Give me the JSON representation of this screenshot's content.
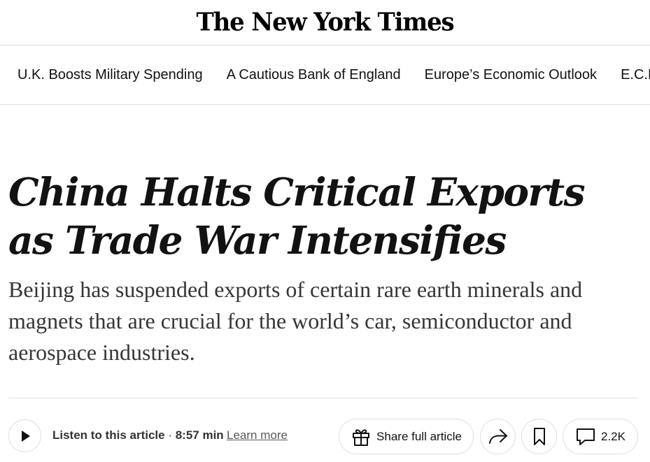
{
  "masthead": {
    "logo_text": "The New York Times"
  },
  "subnav": {
    "items": [
      {
        "label": "U.K. Boosts Military Spending"
      },
      {
        "label": "A Cautious Bank of England"
      },
      {
        "label": "Europe’s Economic Outlook"
      },
      {
        "label": "E.C.B."
      }
    ]
  },
  "article": {
    "headline": "China Halts Critical Exports as Trade War Intensifies",
    "summary": "Beijing has suspended exports of certain rare earth minerals and magnets that are crucial for the world’s car, semiconductor and aerospace industries."
  },
  "actions": {
    "listen_label": "Listen to this article",
    "separator": " · ",
    "duration": "8:57 min",
    "learn_more": "Learn more",
    "share_label": "Share full article",
    "comments_count": "2.2K"
  },
  "icons": {
    "play": "play-icon",
    "gift": "gift-icon",
    "share": "share-arrow-icon",
    "bookmark": "bookmark-icon",
    "comment": "comment-icon"
  }
}
